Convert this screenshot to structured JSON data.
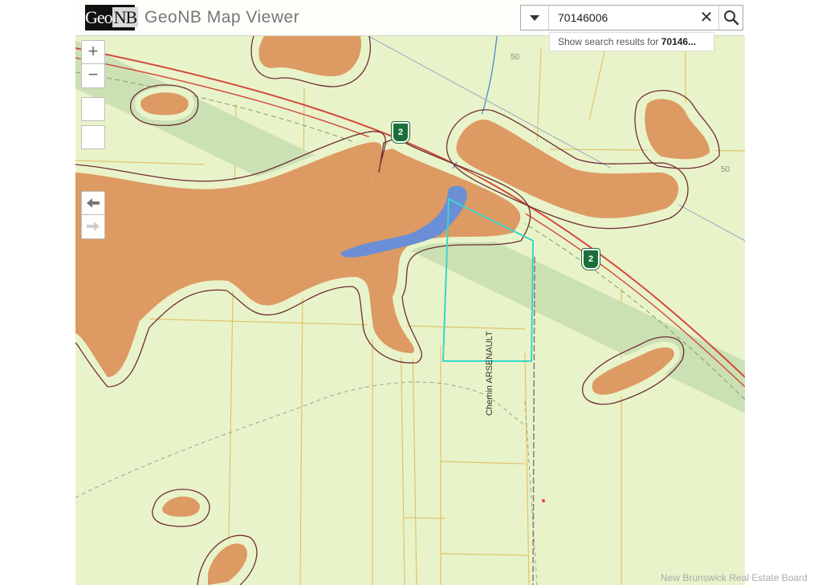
{
  "header": {
    "logo_text": "Geo",
    "logo_nb": "NB",
    "title": "GeoNB Map Viewer"
  },
  "search": {
    "value": "70146006",
    "suggestion_prefix": "Show search results for ",
    "suggestion_term": "70146..."
  },
  "map_controls": {
    "zoom_in": "+",
    "zoom_out": "−",
    "back": "🡄",
    "forward": "🡆"
  },
  "map": {
    "road_name": "Chemin ARSENAULT",
    "highway_number": "2",
    "contour_labels": [
      "50",
      "50"
    ],
    "colors": {
      "background": "#e9f3c9",
      "flood_fill": "#dd9a63",
      "flood_outline": "#6e2e36",
      "water": "#6b8fd6",
      "parcel": "#3ad5cc",
      "highway_band": "#c9dfb0",
      "highway_line": "#d2493b",
      "lot_lines": "#e0c36a"
    }
  },
  "watermark": "New Brunswick Real Estate Board"
}
